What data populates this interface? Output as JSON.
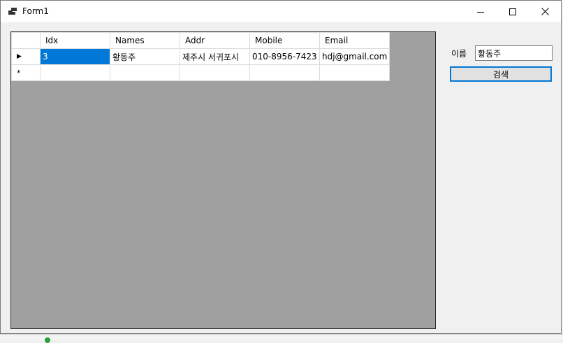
{
  "window": {
    "title": "Form1"
  },
  "grid": {
    "columns": [
      "Idx",
      "Names",
      "Addr",
      "Mobile",
      "Email"
    ],
    "rows": [
      [
        "3",
        "황동주",
        "제주시 서귀포시",
        "010-8956-7423",
        "hdj@gmail.com"
      ]
    ],
    "new_row_marker": "*",
    "current_row_marker": "▶"
  },
  "search": {
    "label": "이름",
    "value": "황동주",
    "button_label": "검색"
  },
  "colors": {
    "selection": "#0078d7",
    "grid_background": "#a0a0a0",
    "window_background": "#f0f0f0",
    "focus_border": "#0078d7"
  }
}
